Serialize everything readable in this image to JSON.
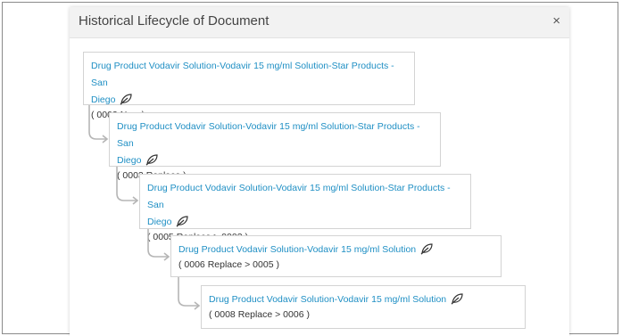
{
  "dialog": {
    "title": "Historical Lifecycle of Document",
    "close_label": "×"
  },
  "lifecycle": [
    {
      "title_line1": "Drug Product Vodavir Solution-Vodavir 15 mg/ml Solution-Star Products - San",
      "title_line2": "Diego",
      "status": "( 0002 New )"
    },
    {
      "title_line1": "Drug Product Vodavir Solution-Vodavir 15 mg/ml Solution-Star Products - San",
      "title_line2": "Diego",
      "status": "( 0003 Replace )"
    },
    {
      "title_line1": "Drug Product Vodavir Solution-Vodavir 15 mg/ml Solution-Star Products - San",
      "title_line2": "Diego",
      "status": "( 0005 Replace > 0003 )"
    },
    {
      "title_line1": "Drug Product Vodavir Solution-Vodavir 15 mg/ml Solution",
      "title_line2": "",
      "status": "( 0006 Replace > 0005 )"
    },
    {
      "title_line1": "Drug Product Vodavir Solution-Vodavir 15 mg/ml Solution",
      "title_line2": "",
      "status": "( 0008 Replace > 0006 )"
    }
  ],
  "icons": {
    "node_icon": "leaf-icon"
  },
  "colors": {
    "link": "#1f8fc4",
    "connector": "#b5b5b5",
    "header_bg": "#f2f2f2"
  }
}
